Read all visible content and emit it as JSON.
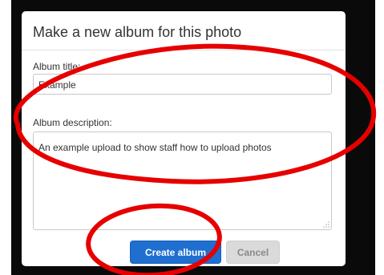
{
  "dialog": {
    "title": "Make a new album for this photo",
    "album_title_label": "Album title:",
    "album_title_value": "Example",
    "album_description_label": "Album description:",
    "album_description_value": "An example upload to show staff how to upload photos",
    "create_button_label": "Create album",
    "cancel_button_label": "Cancel"
  },
  "colors": {
    "primary_button": "#1f6fd1",
    "annotation_stroke": "#e60000",
    "backdrop": "#0a0a0a"
  }
}
